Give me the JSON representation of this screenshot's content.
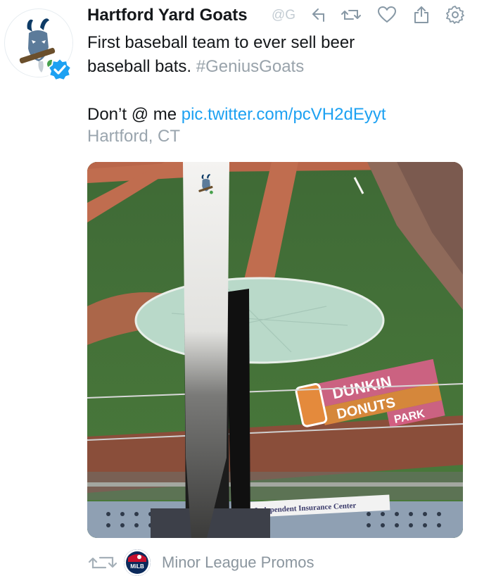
{
  "tweet": {
    "author_name": "Hartford Yard Goats",
    "author_handle": "@G",
    "text_line1": "First baseball team to ever sell beer",
    "text_line2_main": "baseball bats. ",
    "hashtag": "#GeniusGoats",
    "text_line3_main": "Don’t @ me ",
    "link": "pic.twitter.com/pcVH2dEyyt",
    "location": "Hartford, CT"
  },
  "image_text": {
    "dunkin_line1": "DUNKIN",
    "dunkin_line2": "DONUTS",
    "dunkin_line3": "PARK",
    "sign": "Independent Insurance Center"
  },
  "icons": {
    "reply": "reply-icon",
    "retweet": "retweet-icon",
    "like": "heart-icon",
    "share": "share-icon",
    "settings": "gear-icon"
  },
  "footer": {
    "retweeted_by": "Minor League Promos",
    "mini_avatar_text": "MiLB"
  },
  "colors": {
    "link": "#1da1f2",
    "verified": "#1da1f2",
    "muted": "#8a959e"
  }
}
